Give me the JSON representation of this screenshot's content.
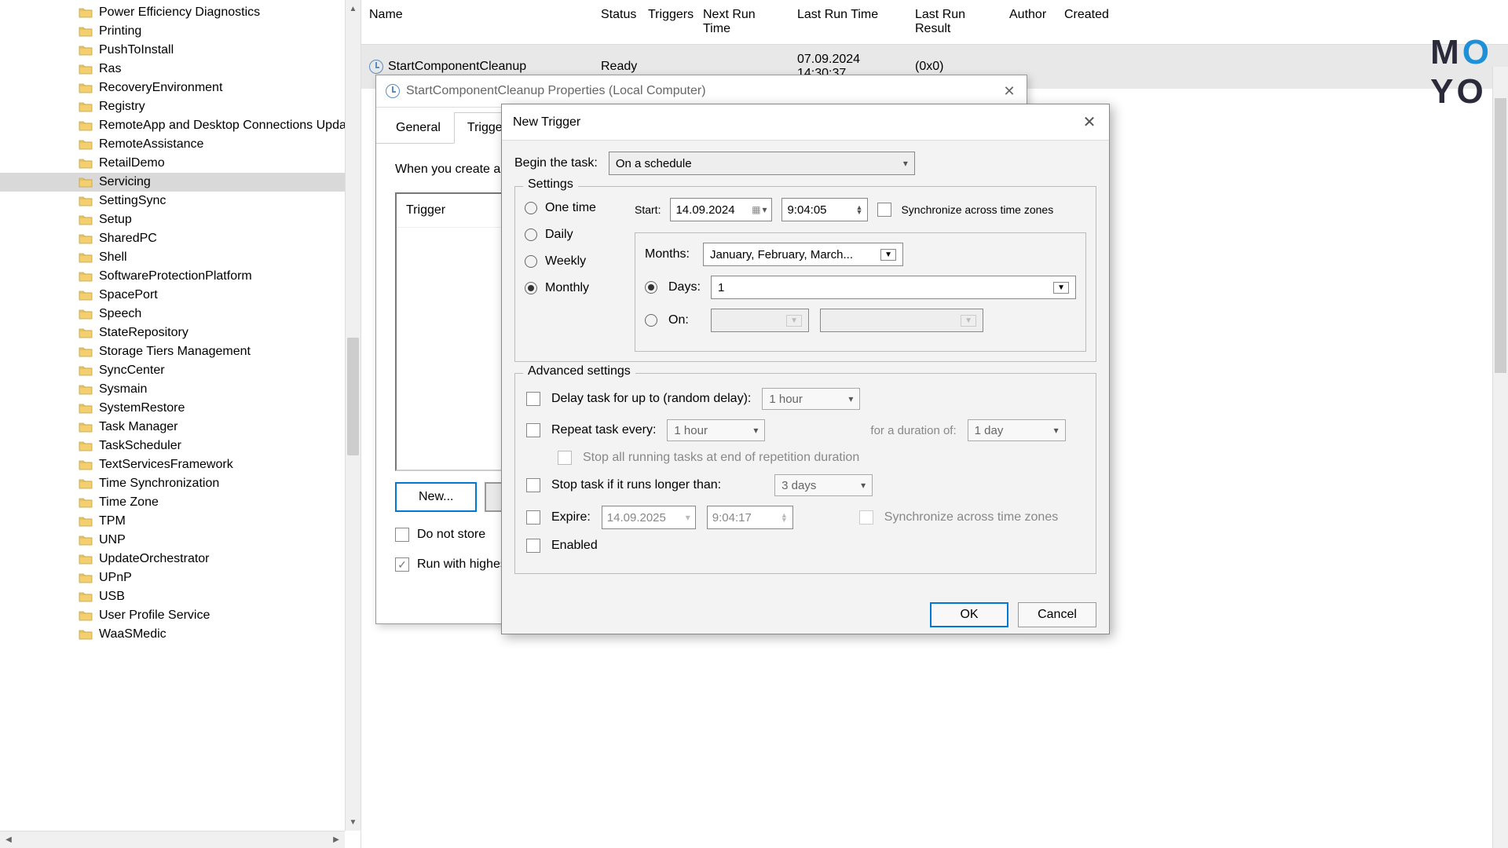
{
  "tree": {
    "items": [
      "Power Efficiency Diagnostics",
      "Printing",
      "PushToInstall",
      "Ras",
      "RecoveryEnvironment",
      "Registry",
      "RemoteApp and Desktop Connections Upda",
      "RemoteAssistance",
      "RetailDemo",
      "Servicing",
      "SettingSync",
      "Setup",
      "SharedPC",
      "Shell",
      "SoftwareProtectionPlatform",
      "SpacePort",
      "Speech",
      "StateRepository",
      "Storage Tiers Management",
      "SyncCenter",
      "Sysmain",
      "SystemRestore",
      "Task Manager",
      "TaskScheduler",
      "TextServicesFramework",
      "Time Synchronization",
      "Time Zone",
      "TPM",
      "UNP",
      "UpdateOrchestrator",
      "UPnP",
      "USB",
      "User Profile Service",
      "WaaSMedic"
    ],
    "selected_index": 9
  },
  "task_list": {
    "columns": [
      "Name",
      "Status",
      "Triggers",
      "Next Run Time",
      "Last Run Time",
      "Last Run Result",
      "Author",
      "Created"
    ],
    "row": {
      "name": "StartComponentCleanup",
      "status": "Ready",
      "triggers": "",
      "next_run": "",
      "last_run": "07.09.2024 14:30:37",
      "last_result": "(0x0)",
      "author": "",
      "created": ""
    }
  },
  "props": {
    "title": "StartComponentCleanup Properties (Local Computer)",
    "tabs": {
      "general": "General",
      "triggers": "Triggers"
    },
    "hint": "When you create a",
    "trigger_header": "Trigger",
    "new_btn": "New...",
    "do_not_store": "Do not store",
    "run_highest": "Run with highes"
  },
  "nt": {
    "title": "New Trigger",
    "begin_label": "Begin the task:",
    "begin_value": "On a schedule",
    "settings_label": "Settings",
    "radios": {
      "one_time": "One time",
      "daily": "Daily",
      "weekly": "Weekly",
      "monthly": "Monthly"
    },
    "start_label": "Start:",
    "start_date": "14.09.2024",
    "start_time": "9:04:05",
    "sync_tz": "Synchronize across time zones",
    "months_label": "Months:",
    "months_value": "January, February, March...",
    "days_label": "Days:",
    "days_value": "1",
    "on_label": "On:",
    "adv_label": "Advanced settings",
    "delay_label": "Delay task for up to (random delay):",
    "delay_value": "1 hour",
    "repeat_label": "Repeat task every:",
    "repeat_value": "1 hour",
    "duration_label": "for a duration of:",
    "duration_value": "1 day",
    "stop_all": "Stop all running tasks at end of repetition duration",
    "stop_longer": "Stop task if it runs longer than:",
    "stop_value": "3 days",
    "expire_label": "Expire:",
    "expire_date": "14.09.2025",
    "expire_time": "9:04:17",
    "sync_tz2": "Synchronize across time zones",
    "enabled": "Enabled",
    "ok": "OK",
    "cancel": "Cancel"
  },
  "watermark": {
    "m": "M",
    "o1": "O",
    "y": "Y",
    "o2": "O"
  }
}
